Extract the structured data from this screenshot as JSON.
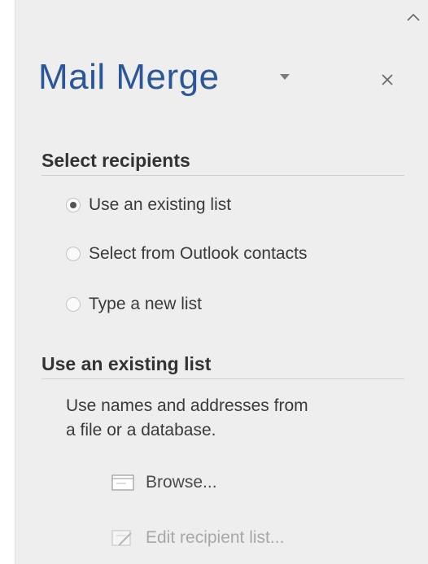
{
  "pane": {
    "title": "Mail Merge",
    "icons": {
      "collapse": "chevron-up-icon",
      "title_dropdown": "caret-down-icon",
      "close": "close-icon"
    }
  },
  "select_recipients": {
    "heading": "Select recipients",
    "options": [
      {
        "label": "Use an existing list",
        "selected": true
      },
      {
        "label": "Select from Outlook contacts",
        "selected": false
      },
      {
        "label": "Type a new list",
        "selected": false
      }
    ]
  },
  "existing_list": {
    "heading": "Use an existing list",
    "description_line1": "Use names and addresses from",
    "description_line2": "a file or a database.",
    "browse_label": "Browse...",
    "browse_icon": "browse-file-icon",
    "edit_label": "Edit recipient list...",
    "edit_icon": "edit-list-icon",
    "edit_enabled": false
  },
  "colors": {
    "title": "#2b579a",
    "pane_background": "#eeeeee",
    "text": "#3a3a3a",
    "disabled_text": "#a8a8a8"
  }
}
